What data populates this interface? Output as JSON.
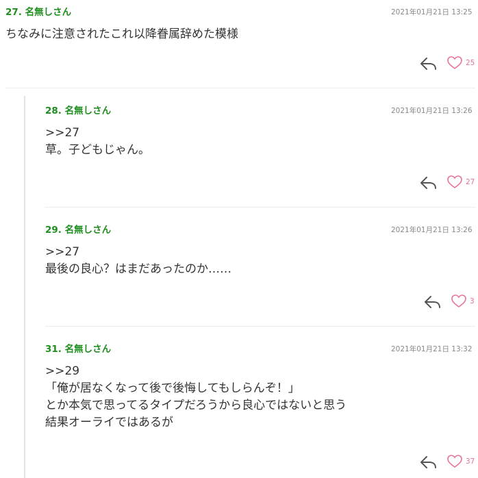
{
  "comments": [
    {
      "number": "27.",
      "name": "名無しさん",
      "date": "2021年01月21日 13:25",
      "lines": [
        "ちなみに注意されたこれ以降眷属辞めた模様"
      ],
      "likes": "25"
    },
    {
      "number": "28.",
      "name": "名無しさん",
      "date": "2021年01月21日 13:26",
      "lines": [
        ">>27",
        "草。子どもじゃん。"
      ],
      "likes": "27"
    },
    {
      "number": "29.",
      "name": "名無しさん",
      "date": "2021年01月21日 13:26",
      "lines": [
        ">>27",
        "最後の良心？はまだあったのか‥‥‥"
      ],
      "likes": "3"
    },
    {
      "number": "31.",
      "name": "名無しさん",
      "date": "2021年01月21日 13:32",
      "lines": [
        ">>29",
        "「俺が居なくなって後で後悔してもしらんぞ！」",
        "とか本気で思ってるタイプだろうから良心ではないと思う",
        "結果オーライではあるが"
      ],
      "likes": "37"
    }
  ],
  "colors": {
    "name": "#1e8f1e",
    "heart": "#e5739c",
    "date": "#888888"
  },
  "icons": {
    "reply": "reply-arrow-icon",
    "like": "heart-outline-icon"
  }
}
